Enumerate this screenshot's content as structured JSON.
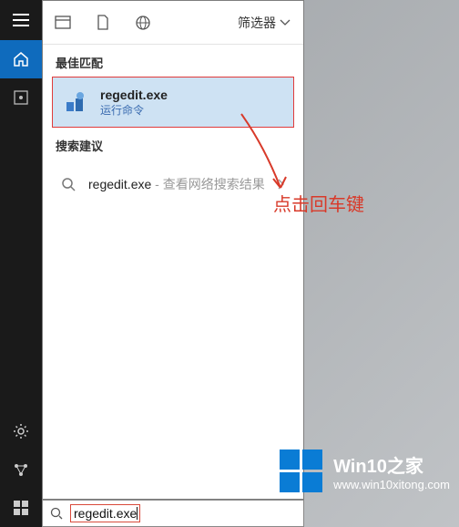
{
  "annotation": {
    "text": "点击回车键"
  },
  "tabs": {
    "filter_label": "筛选器"
  },
  "sections": {
    "best_match_label": "最佳匹配",
    "suggestions_label": "搜索建议"
  },
  "best_match": {
    "title": "regedit.exe",
    "subtitle": "运行命令"
  },
  "suggestion": {
    "text": "regedit.exe",
    "extra": " - 查看网络搜索结果"
  },
  "search": {
    "value": "regedit.exe"
  },
  "watermark": {
    "title": "Win10之家",
    "url": "www.win10xitong.com"
  }
}
